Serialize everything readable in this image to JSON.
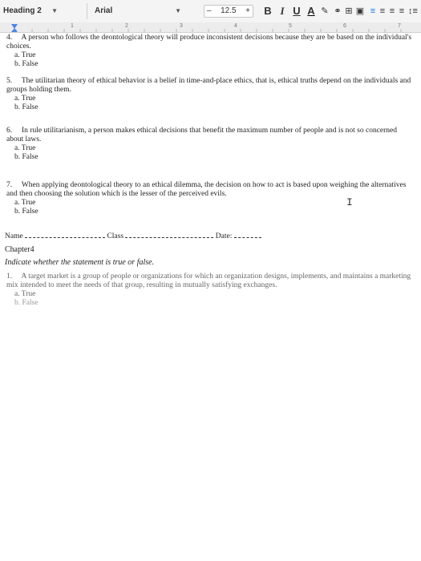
{
  "toolbar": {
    "style": "Heading 2",
    "font": "Arial",
    "size_minus": "–",
    "font_size": "12.5",
    "size_plus": "+",
    "bold": "B",
    "italic": "I",
    "underline": "U",
    "text_color": "A",
    "highlight": "✎",
    "link": "⚭",
    "insert": "⊞",
    "image": "▣",
    "align_left": "≡",
    "align_center": "≡",
    "align_right": "≡",
    "justify": "≡",
    "line_spacing": "↕≡",
    "list": "⋮≡"
  },
  "ruler": {
    "marks": [
      "1",
      "2",
      "3",
      "4",
      "5",
      "6",
      "7"
    ]
  },
  "questions": [
    {
      "number": "4.",
      "text": "A person who follows the deontological theory will produce inconsistent decisions because they are be based on the individual's choices.",
      "options": [
        "a. True",
        "b. False"
      ]
    },
    {
      "number": "5.",
      "text": "The utilitarian theory of ethical behavior is a belief in time-and-place ethics, that is, ethical truths depend on the individuals and groups holding them.",
      "options": [
        "a. True",
        "b. False"
      ]
    },
    {
      "number": "6.",
      "text": "In rule utilitarianism, a person makes ethical decisions that benefit the maximum number of people and is not so concerned about laws.",
      "options": [
        "a. True",
        "b. False"
      ]
    },
    {
      "number": "7.",
      "text": "When applying deontological theory to an ethical dilemma, the decision on how to act is based upon weighing the alternatives and then choosing the solution which is the lesser of the perceived evils.",
      "options": [
        "a. True",
        "b. False"
      ]
    }
  ],
  "header_line": {
    "name": "Name",
    "class": "Class",
    "date": "Date:"
  },
  "chapter": "Chapter4",
  "instruction": "Indicate whether the statement is true or false.",
  "q1": {
    "number": "1.",
    "text": "A target market is a group of people or organizations for which an organization designs, implements, and maintains a marketing mix intended to meet the needs of that group, resulting in mutually satisfying exchanges.",
    "options": [
      "a. True",
      "b. False"
    ]
  }
}
